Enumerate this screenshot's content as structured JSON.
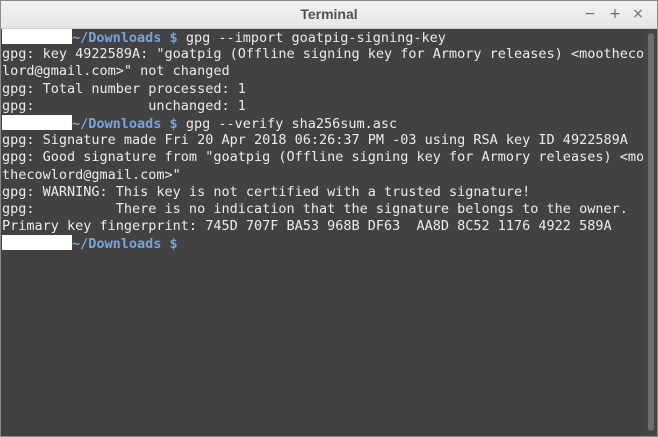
{
  "window": {
    "title": "Terminal",
    "controls": {
      "minimize": "−",
      "maximize": "+",
      "close": "×"
    }
  },
  "terminal": {
    "prompt_path": "~/Downloads",
    "prompt_symbol": "$",
    "lines": [
      {
        "type": "prompt",
        "command": "gpg --import goatpig-signing-key"
      },
      {
        "type": "output",
        "text": "gpg: key 4922589A: \"goatpig (Offline signing key for Armory releases) <moothecow"
      },
      {
        "type": "output",
        "text": "lord@gmail.com>\" not changed"
      },
      {
        "type": "output",
        "text": "gpg: Total number processed: 1"
      },
      {
        "type": "output",
        "text": "gpg:              unchanged: 1"
      },
      {
        "type": "prompt",
        "command": "gpg --verify sha256sum.asc"
      },
      {
        "type": "output",
        "text": "gpg: Signature made Fri 20 Apr 2018 06:26:37 PM -03 using RSA key ID 4922589A"
      },
      {
        "type": "output",
        "text": "gpg: Good signature from \"goatpig (Offline signing key for Armory releases) <moo"
      },
      {
        "type": "output",
        "text": "thecowlord@gmail.com>\""
      },
      {
        "type": "output",
        "text": "gpg: WARNING: This key is not certified with a trusted signature!"
      },
      {
        "type": "output",
        "text": "gpg:          There is no indication that the signature belongs to the owner."
      },
      {
        "type": "output",
        "text": "Primary key fingerprint: 745D 707F BA53 968B DF63  AA8D 8C52 1176 4922 589A"
      },
      {
        "type": "prompt",
        "command": ""
      }
    ]
  },
  "colors": {
    "terminal_bg": "#424242",
    "text": "#ececec",
    "prompt": "#7aa4d8"
  }
}
